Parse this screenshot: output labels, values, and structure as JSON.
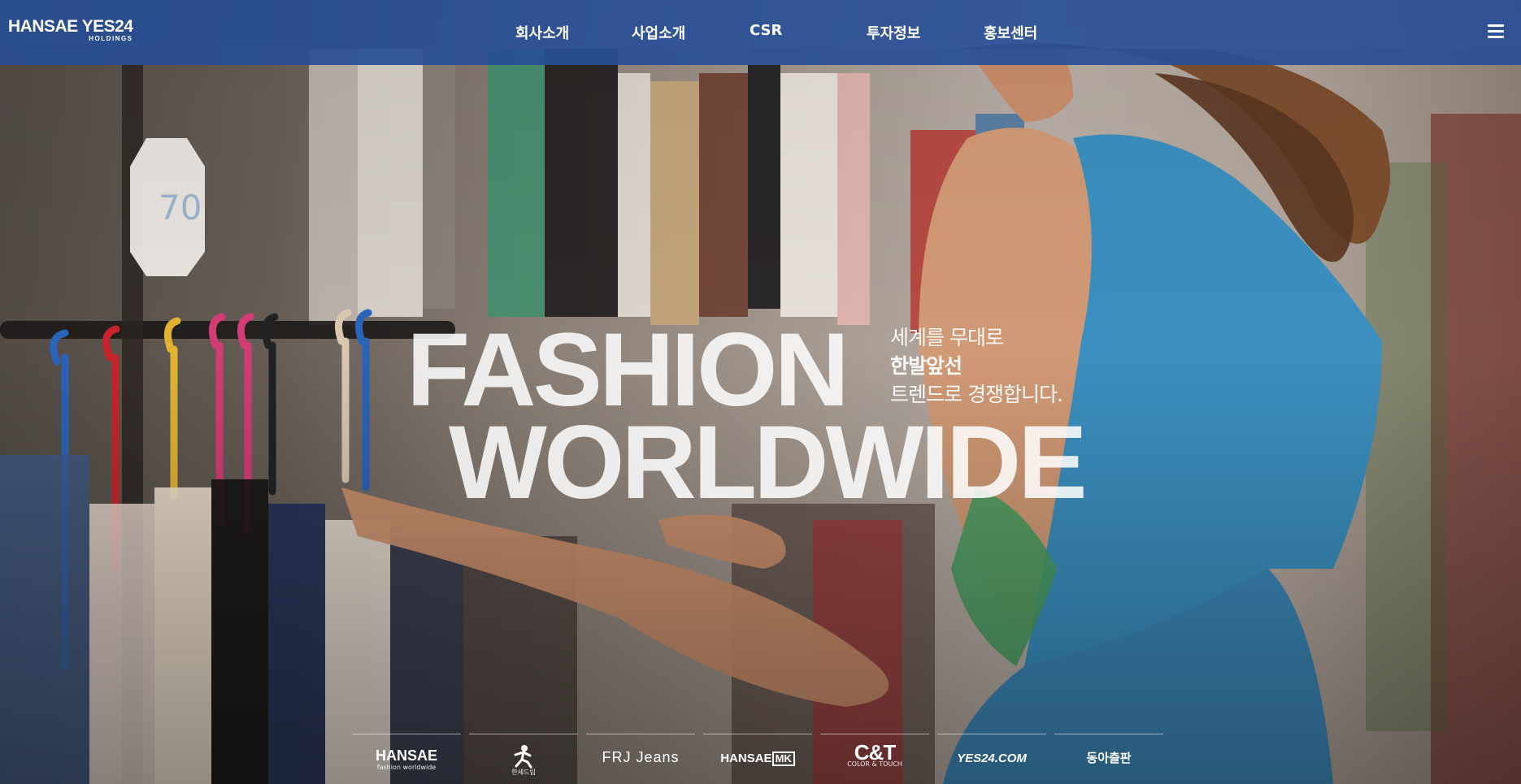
{
  "header": {
    "logo": {
      "main": "HANSAE YES24",
      "sub": "HOLDINGS"
    },
    "nav": [
      {
        "label": "회사소개"
      },
      {
        "label": "사업소개"
      },
      {
        "label": "CSR"
      },
      {
        "label": "투자정보"
      },
      {
        "label": "홍보센터"
      }
    ],
    "menu_icon": "hamburger-menu-icon"
  },
  "hero": {
    "headline_line1": "FASHION",
    "headline_line2": "WORLDWIDE",
    "tagline": {
      "line1": "세계를 무대로",
      "line2": "한발앞선",
      "line3": "트렌드로 경쟁합니다."
    }
  },
  "brands": [
    {
      "name": "HANSAE",
      "sub": "fashion worldwide"
    },
    {
      "name": "",
      "sub": "한세드림",
      "icon": "running-figure-icon"
    },
    {
      "name": "FRJ Jeans"
    },
    {
      "name": "HANSAE",
      "badge": "MK"
    },
    {
      "name": "C&T",
      "sub": "COLOR & TOUCH"
    },
    {
      "name": "YES24.COM"
    },
    {
      "name": "동아출판"
    }
  ],
  "colors": {
    "header_bg": "#284e96",
    "text": "#ffffff"
  }
}
